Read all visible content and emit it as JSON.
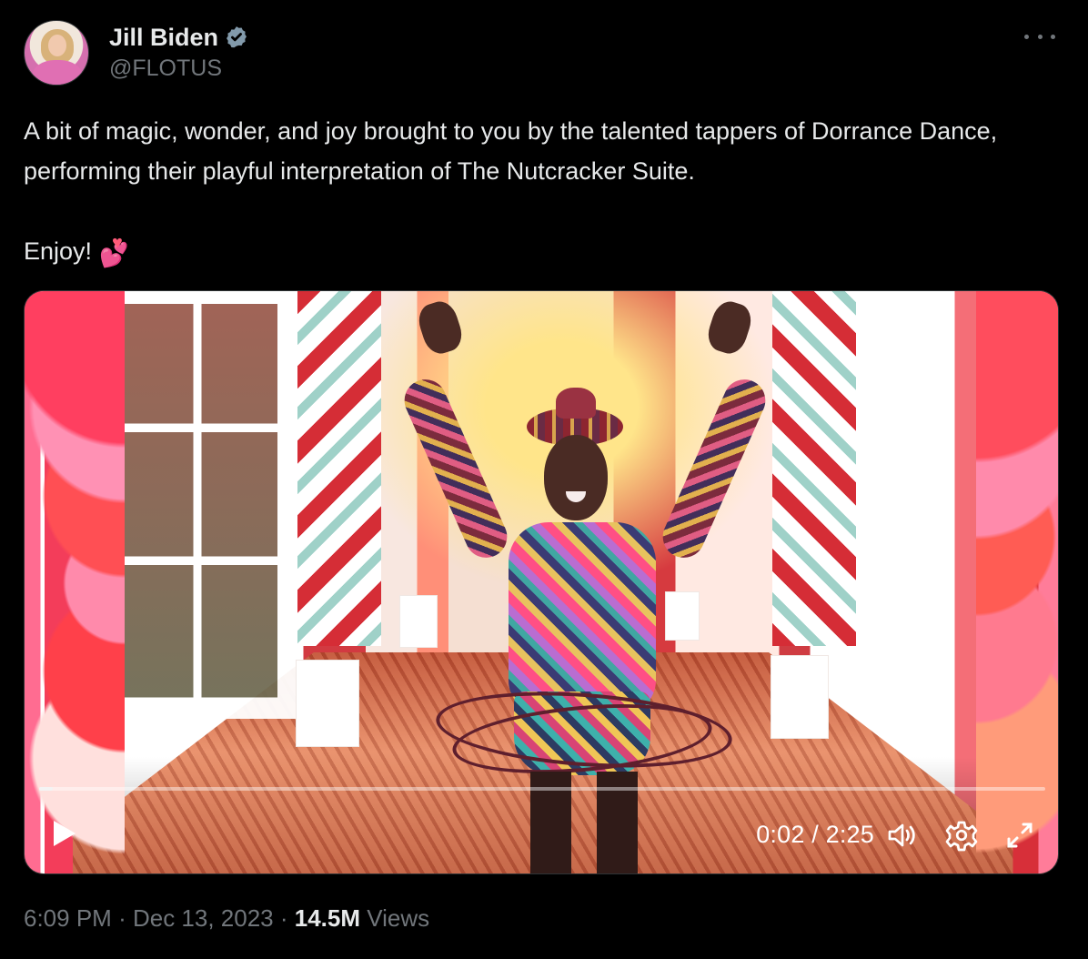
{
  "author": {
    "name": "Jill Biden",
    "handle": "@FLOTUS",
    "verified": true,
    "avatar_icon": "profile-photo"
  },
  "tweet": {
    "paragraphs": [
      "A bit of magic, wonder, and joy brought to you by the talented tappers of Dorrance Dance, performing their playful interpretation of The Nutcracker Suite.",
      "Enjoy!"
    ],
    "emoji": "💕"
  },
  "media": {
    "type": "video",
    "current_time": "0:02",
    "duration": "2:25",
    "time_display": "0:02 / 2:25",
    "progress": 0.014,
    "controls": {
      "play_icon": "play-icon",
      "volume_icon": "volume-icon",
      "settings_icon": "gear-icon",
      "fullscreen_icon": "expand-icon"
    }
  },
  "metadata": {
    "time": "6:09 PM",
    "date": "Dec 13, 2023",
    "views_count": "14.5M",
    "views_label": "Views"
  },
  "colors": {
    "background": "#000000",
    "primary_text": "#e7e9ea",
    "secondary_text": "#71767b",
    "border": "#2f3336"
  }
}
